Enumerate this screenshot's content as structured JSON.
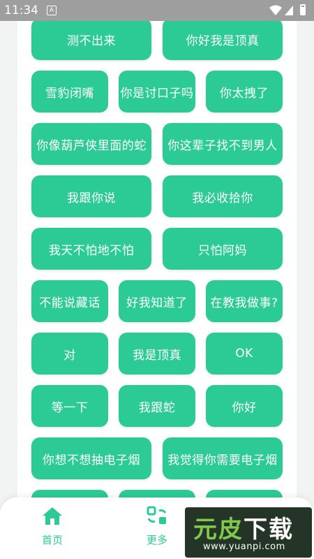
{
  "status_bar": {
    "time": "11:34",
    "badge": "A"
  },
  "buttons": [
    "",
    "",
    "测不出来",
    "你好我是顶真",
    "雪豹闭嘴",
    "你是讨口子吗",
    "你太拽了",
    "你像葫芦侠里面的蛇",
    "你这辈子找不到男人",
    "我跟你说",
    "我必收拾你",
    "我天不怕地不怕",
    "只怕阿妈",
    "不能说藏话",
    "好我知道了",
    "在教我做事?",
    "对",
    "我是顶真",
    "OK",
    "等一下",
    "我跟蛇",
    "你好",
    "你想不想抽电子烟",
    "我觉得你需要电子烟",
    "",
    "",
    ""
  ],
  "bottom_nav": {
    "home_label": "首页",
    "more_label": "更多"
  },
  "watermark": {
    "text_green": "元皮",
    "text_white": "下载",
    "url": "www.yuanpi.com"
  },
  "colors": {
    "accent": "#2ccb96",
    "background": "#f1f4f2",
    "status_bar": "#9e9e9e"
  }
}
